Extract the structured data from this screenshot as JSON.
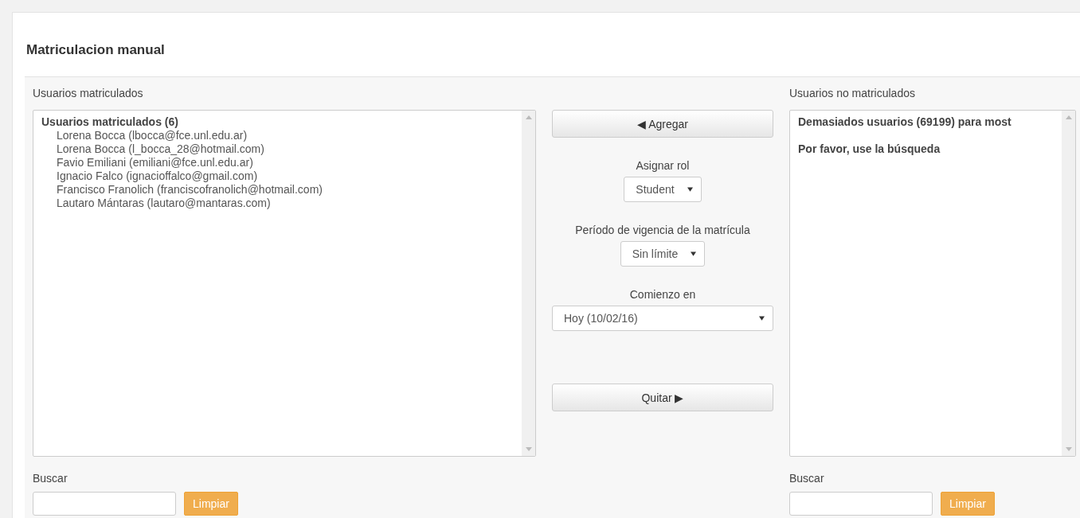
{
  "title": "Matriculacion manual",
  "enrolled": {
    "label": "Usuarios matriculados",
    "group": "Usuarios matriculados (6)",
    "users": [
      {
        "text": "Lorena Bocca (lbocca@fce.unl.edu.ar)"
      },
      {
        "text": "Lorena Bocca (l_bocca_28@hotmail.com)"
      },
      {
        "text": "Favio Emiliani (emiliani@fce.unl.edu.ar)"
      },
      {
        "text": "Ignacio Falco (ignacioffalco@gmail.com)"
      },
      {
        "text": "Francisco Franolich (franciscofranolich@hotmail.com)"
      },
      {
        "text": "Lautaro Mántaras (lautaro@mantaras.com)"
      }
    ],
    "search_label": "Buscar",
    "clear_button": "Limpiar"
  },
  "actions": {
    "add_button": "◀ Agregar",
    "role_label": "Asignar rol",
    "role_value": "Student",
    "period_label": "Período de vigencia de la matrícula",
    "period_value": "Sin límite",
    "start_label": "Comienzo en",
    "start_value": "Hoy (10/02/16)",
    "remove_button": "Quitar ▶"
  },
  "not_enrolled": {
    "label": "Usuarios no matriculados",
    "messages": [
      "Demasiados usuarios (69199) para most",
      "Por favor, use la búsqueda"
    ],
    "search_label": "Buscar",
    "clear_button": "Limpiar"
  }
}
